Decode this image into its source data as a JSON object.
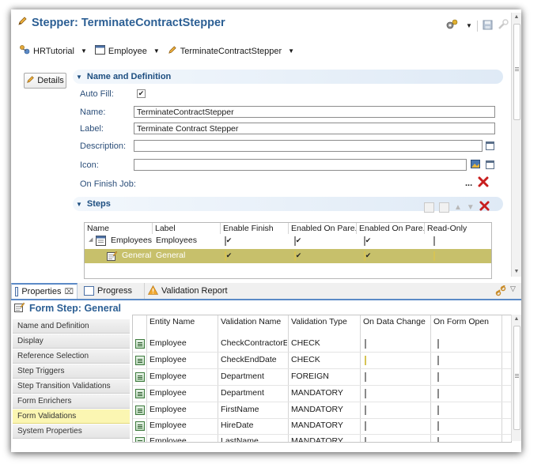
{
  "editor": {
    "title": "Stepper: TerminateContractStepper",
    "breadcrumbs": [
      "HRTutorial",
      "Employee",
      "TerminateContractStepper"
    ],
    "details_button": "Details"
  },
  "name_section": {
    "header": "Name and Definition",
    "auto_fill_label": "Auto Fill:",
    "auto_fill_checked": true,
    "name_label": "Name:",
    "name_value": "TerminateContractStepper",
    "label_label": "Label:",
    "label_value": "Terminate Contract Stepper",
    "description_label": "Description:",
    "description_value": "",
    "icon_label": "Icon:",
    "icon_value": "",
    "on_finish_label": "On Finish Job:",
    "on_finish_dots": "..."
  },
  "steps_section": {
    "header": "Steps",
    "columns": [
      "Name",
      "Label",
      "Enable Finish",
      "Enabled On Pare...",
      "Enabled On Pare...",
      "Read-Only"
    ],
    "rows": [
      {
        "name": "Employees",
        "label": "Employees",
        "checks": [
          true,
          true,
          true,
          false
        ],
        "selected": false
      },
      {
        "name": "General",
        "label": "General",
        "checks": [
          true,
          true,
          true,
          false
        ],
        "selected": true
      }
    ]
  },
  "bottom_tabs": [
    "Properties",
    "Progress",
    "Validation Report"
  ],
  "form_step": {
    "title": "Form Step: General",
    "nav_items": [
      "Name and Definition",
      "Display",
      "Reference Selection",
      "Step Triggers",
      "Step Transition Validations",
      "Form Enrichers",
      "Form Validations",
      "System Properties"
    ],
    "selected_nav": "Form Validations",
    "columns": [
      "Entity Name",
      "Validation Name",
      "Validation Type",
      "On Data Change",
      "On Form Open"
    ],
    "rows": [
      {
        "entity": "Employee",
        "name": "CheckContractorE...",
        "type": "CHECK",
        "on_data_change": false,
        "on_form_open": false
      },
      {
        "entity": "Employee",
        "name": "CheckEndDate",
        "type": "CHECK",
        "on_data_change": false,
        "on_form_open": false
      },
      {
        "entity": "Employee",
        "name": "Department",
        "type": "FOREIGN",
        "on_data_change": false,
        "on_form_open": false
      },
      {
        "entity": "Employee",
        "name": "Department",
        "type": "MANDATORY",
        "on_data_change": false,
        "on_form_open": false
      },
      {
        "entity": "Employee",
        "name": "FirstName",
        "type": "MANDATORY",
        "on_data_change": false,
        "on_form_open": false
      },
      {
        "entity": "Employee",
        "name": "HireDate",
        "type": "MANDATORY",
        "on_data_change": false,
        "on_form_open": false
      },
      {
        "entity": "Employee",
        "name": "LastName",
        "type": "MANDATORY",
        "on_data_change": false,
        "on_form_open": false
      }
    ]
  },
  "colors": {
    "title": "#2c5f94",
    "selection": "#c8c06a",
    "nav_selected": "#fbf6b2",
    "delete": "#cc2020"
  }
}
